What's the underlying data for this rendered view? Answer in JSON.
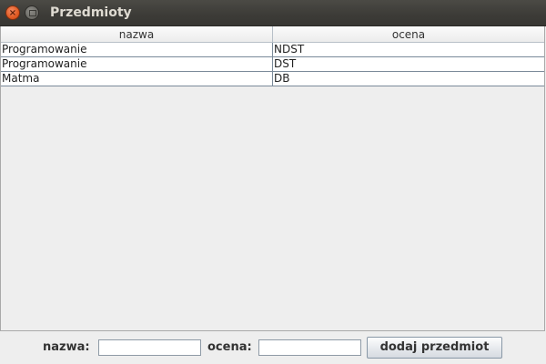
{
  "window": {
    "title": "Przedmioty"
  },
  "table": {
    "columns": [
      "nazwa",
      "ocena"
    ],
    "rows": [
      [
        "Programowanie",
        "NDST"
      ],
      [
        "Programowanie",
        "DST"
      ],
      [
        "Matma",
        "DB"
      ]
    ]
  },
  "form": {
    "name_label": "nazwa:",
    "name_value": "",
    "grade_label": "ocena:",
    "grade_value": "",
    "submit_label": "dodaj przedmiot"
  },
  "icons": {
    "close": "close-icon",
    "maximize": "maximize-icon"
  },
  "colors": {
    "titlebar": "#3c3b37",
    "close_button": "#e15a22",
    "window_bg": "#eeeeee"
  }
}
